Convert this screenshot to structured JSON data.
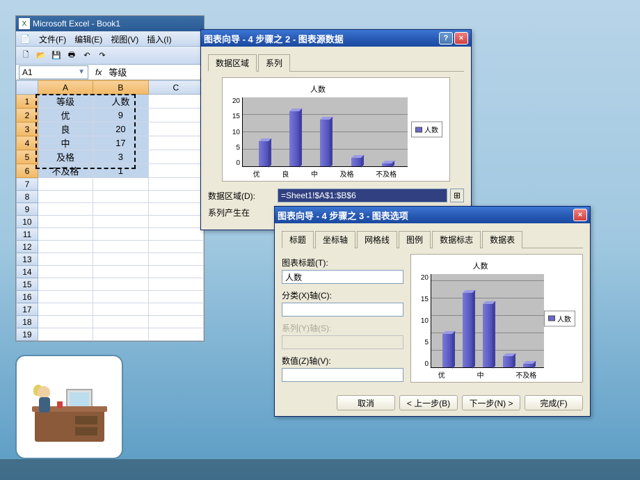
{
  "app": {
    "title": "Microsoft Excel - Book1",
    "menus": [
      "文件(F)",
      "编辑(E)",
      "视图(V)",
      "插入(I)"
    ],
    "namebox": "A1",
    "formula_bar": "等级"
  },
  "sheet": {
    "columns": [
      "A",
      "B",
      "C"
    ],
    "rows": [
      {
        "n": 1,
        "A": "等级",
        "B": "人数",
        "C": ""
      },
      {
        "n": 2,
        "A": "优",
        "B": "9",
        "C": ""
      },
      {
        "n": 3,
        "A": "良",
        "B": "20",
        "C": ""
      },
      {
        "n": 4,
        "A": "中",
        "B": "17",
        "C": ""
      },
      {
        "n": 5,
        "A": "及格",
        "B": "3",
        "C": ""
      },
      {
        "n": 6,
        "A": "不及格",
        "B": "1",
        "C": ""
      },
      {
        "n": 7,
        "A": "",
        "B": "",
        "C": ""
      },
      {
        "n": 8,
        "A": "",
        "B": "",
        "C": ""
      },
      {
        "n": 9,
        "A": "",
        "B": "",
        "C": ""
      },
      {
        "n": 10,
        "A": "",
        "B": "",
        "C": ""
      },
      {
        "n": 11,
        "A": "",
        "B": "",
        "C": ""
      },
      {
        "n": 12,
        "A": "",
        "B": "",
        "C": ""
      },
      {
        "n": 13,
        "A": "",
        "B": "",
        "C": ""
      },
      {
        "n": 14,
        "A": "",
        "B": "",
        "C": ""
      },
      {
        "n": 15,
        "A": "",
        "B": "",
        "C": ""
      },
      {
        "n": 16,
        "A": "",
        "B": "",
        "C": ""
      },
      {
        "n": 17,
        "A": "",
        "B": "",
        "C": ""
      },
      {
        "n": 18,
        "A": "",
        "B": "",
        "C": ""
      },
      {
        "n": 19,
        "A": "",
        "B": "",
        "C": ""
      }
    ],
    "selection": {
      "cols": [
        "A",
        "B"
      ],
      "rows": [
        1,
        2,
        3,
        4,
        5,
        6
      ]
    }
  },
  "wizard2": {
    "title": "图表向导 - 4 步骤之 2 - 图表源数据",
    "tabs": [
      "数据区域",
      "系列"
    ],
    "active_tab": 0,
    "data_range_label": "数据区域(D):",
    "data_range_value": "=Sheet1!$A$1:$B$6",
    "series_in_label": "系列产生在"
  },
  "wizard3": {
    "title": "图表向导 - 4 步骤之 3 - 图表选项",
    "tabs": [
      "标题",
      "坐标轴",
      "网格线",
      "图例",
      "数据标志",
      "数据表"
    ],
    "active_tab": 0,
    "chart_title_label": "图表标题(T):",
    "chart_title_value": "人数",
    "cat_axis_label": "分类(X)轴(C):",
    "cat_axis_value": "",
    "series_axis_label": "系列(Y)轴(S):",
    "series_axis_value": "",
    "value_axis_label": "数值(Z)轴(V):",
    "value_axis_value": "",
    "buttons": {
      "cancel": "取消",
      "back": "< 上一步(B)",
      "next": "下一步(N) >",
      "finish": "完成(F)"
    }
  },
  "chart_data": {
    "type": "bar",
    "title": "人数",
    "categories": [
      "优",
      "良",
      "中",
      "及格",
      "不及格"
    ],
    "series": [
      {
        "name": "人数",
        "values": [
          9,
          20,
          17,
          3,
          1
        ]
      }
    ],
    "ylim": [
      0,
      25
    ],
    "yticks": [
      0,
      5,
      10,
      15,
      20
    ],
    "xlabel": "",
    "ylabel": ""
  }
}
